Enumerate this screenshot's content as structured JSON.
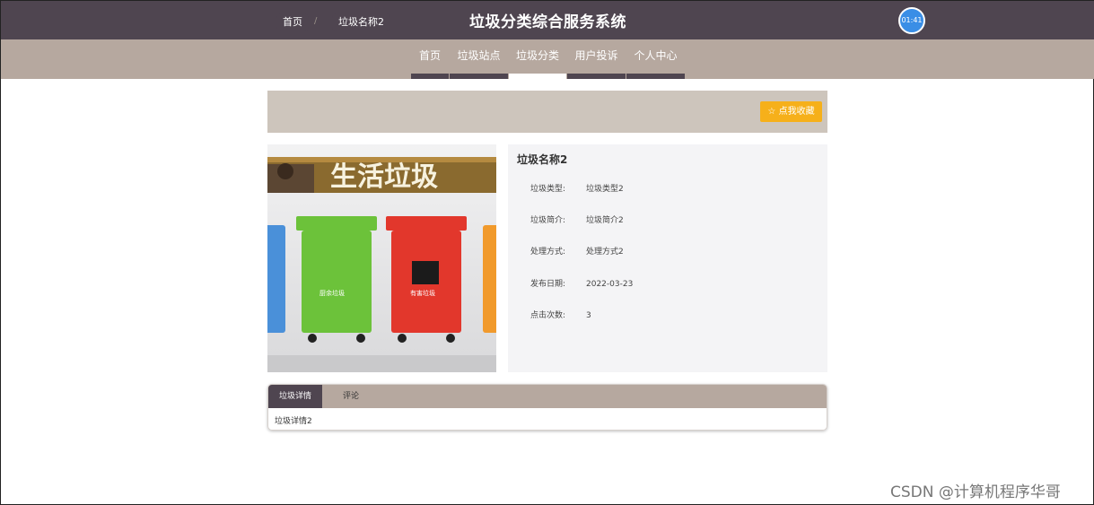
{
  "header": {
    "title": "垃圾分类综合服务系统",
    "clock": "01:41"
  },
  "nav": {
    "items": [
      "首页",
      "垃圾站点",
      "垃圾分类",
      "用户投诉",
      "个人中心"
    ],
    "active_index": 2
  },
  "breadcrumb": {
    "home": "首页",
    "separator": "/",
    "current": "垃圾名称2"
  },
  "favorite_button": "☆ 点我收藏",
  "product_image": {
    "banner_text": "生活垃圾",
    "bin_labels": [
      "厨余垃圾",
      "有害垃圾"
    ],
    "bin_colors": [
      "#4a90d9",
      "#6cc23a",
      "#e2372c",
      "#f19a2c"
    ]
  },
  "details": {
    "name": "垃圾名称2",
    "rows": [
      {
        "label": "垃圾类型:",
        "value": "垃圾类型2"
      },
      {
        "label": "垃圾简介:",
        "value": "垃圾简介2"
      },
      {
        "label": "处理方式:",
        "value": "处理方式2"
      },
      {
        "label": "发布日期:",
        "value": "2022-03-23"
      },
      {
        "label": "点击次数:",
        "value": "3"
      }
    ]
  },
  "tabs": {
    "items": [
      "垃圾详情",
      "评论"
    ],
    "active_index": 0,
    "content": "垃圾详情2"
  },
  "watermark": "CSDN @计算机程序华哥"
}
